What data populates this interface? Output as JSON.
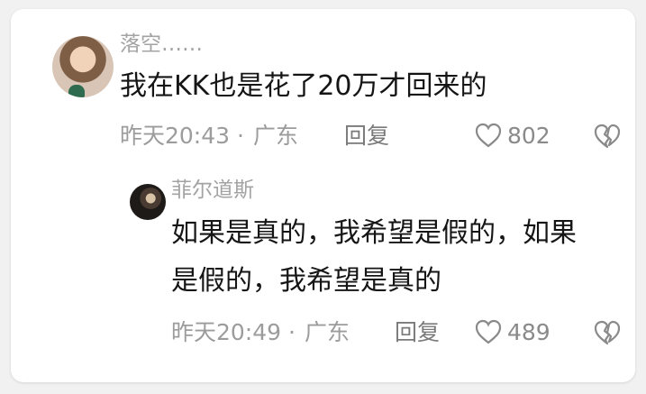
{
  "comments": [
    {
      "user": "落空……",
      "text": "我在KK也是花了20万才回来的",
      "time": "昨天20:43",
      "separator": "·",
      "location": "广东",
      "reply_label": "回复",
      "likes": "802",
      "replies": [
        {
          "user": "菲尔道斯",
          "text_line1": "如果是真的，我希望是假的，如果",
          "text_line2": "是假的，我希望是真的",
          "time": "昨天20:49",
          "separator": "·",
          "location": "广东",
          "reply_label": "回复",
          "likes": "489"
        }
      ]
    }
  ],
  "icons": {
    "like": "heart-outline-icon",
    "dislike": "broken-heart-icon"
  }
}
